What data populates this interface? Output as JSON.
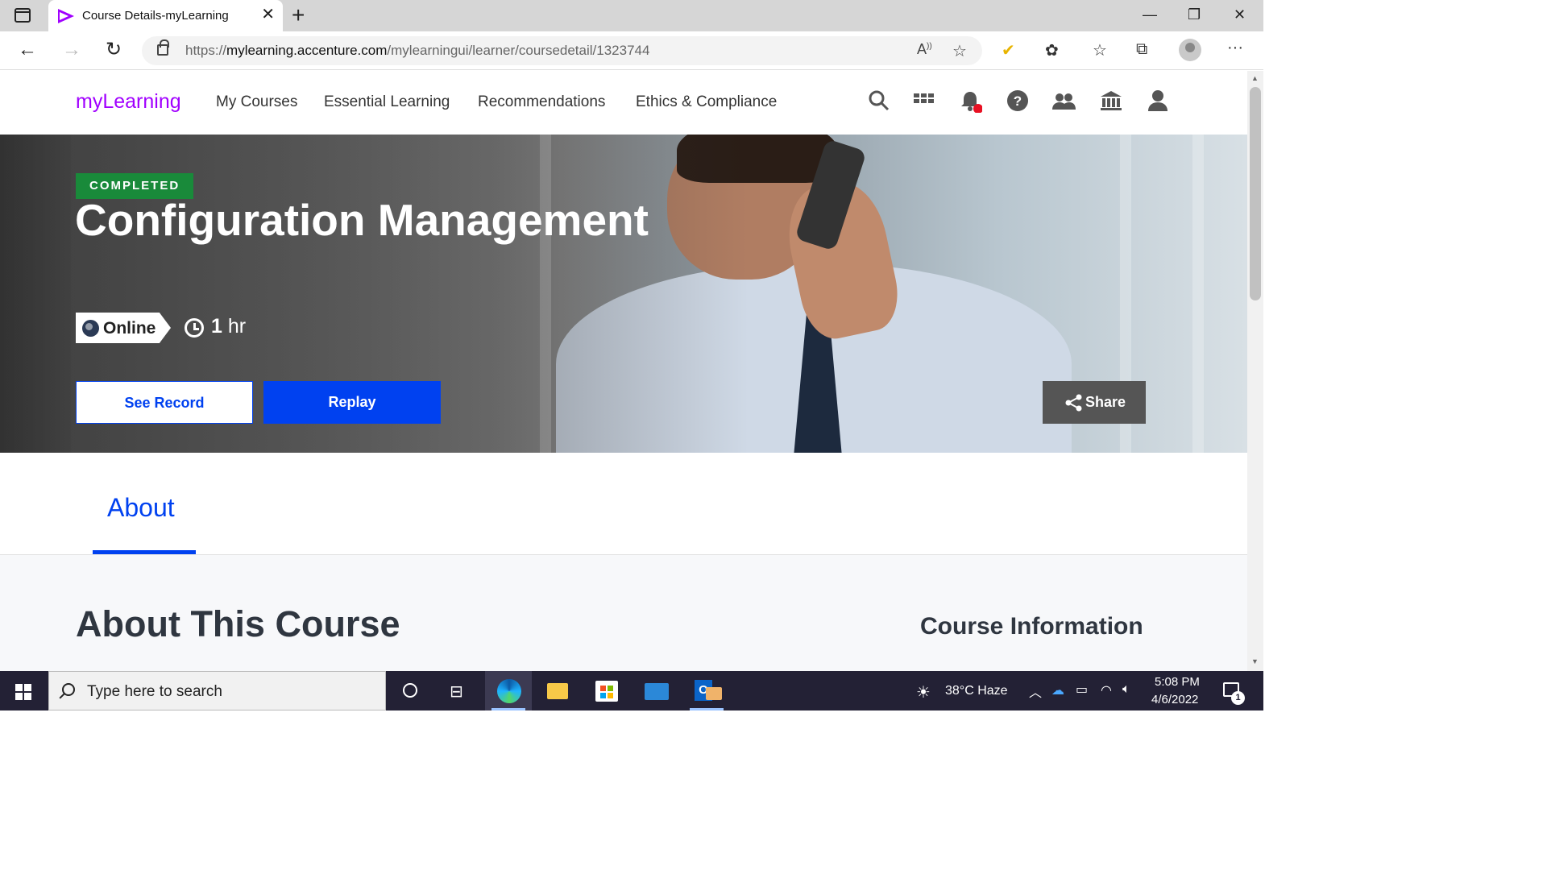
{
  "browser": {
    "tab_title": "Course Details-myLearning",
    "tab_close": "✕",
    "new_tab": "+",
    "url_host_prefix": "https://",
    "url_host": "mylearning.accenture.com",
    "url_path": "/mylearningui/learner/coursedetail/1323744",
    "window_controls": {
      "minimize": "—",
      "restore": "❐",
      "close": "✕"
    },
    "nav": {
      "back": "←",
      "forward": "→",
      "refresh": "↻"
    },
    "toolbar_icons": [
      "read-aloud-icon",
      "add-favorite-icon",
      "norton-icon",
      "extensions-icon",
      "favorites-icon",
      "collections-icon",
      "profile-icon",
      "more-icon"
    ]
  },
  "header": {
    "brand": "myLearning",
    "nav": [
      "My Courses",
      "Essential Learning",
      "Recommendations",
      "Ethics & Compliance"
    ],
    "icons": [
      "search-icon",
      "apps-grid-icon",
      "notifications-bell-icon",
      "help-icon",
      "people-icon",
      "institution-icon",
      "account-icon"
    ],
    "notification_dot_color": "#e81123"
  },
  "hero": {
    "status_badge": "COMPLETED",
    "title": "Configuration Management",
    "mode": "Online",
    "duration_value": "1",
    "duration_unit": " hr",
    "buttons": {
      "see_record": "See Record",
      "replay": "Replay",
      "share": "Share"
    },
    "colors": {
      "badge": "#198a3a",
      "primary": "#0041f0"
    }
  },
  "tabs": {
    "active": "About"
  },
  "content": {
    "about_heading": "About This Course",
    "info_heading": "Course Information"
  },
  "taskbar": {
    "search_placeholder": "Type here to search",
    "weather": "38°C  Haze",
    "time": "5:08 PM",
    "date": "4/6/2022",
    "notification_count": "1",
    "apps": [
      "cortana-icon",
      "task-view-icon",
      "edge-icon",
      "file-explorer-icon",
      "store-icon",
      "mail-icon",
      "outlook-icon"
    ]
  }
}
